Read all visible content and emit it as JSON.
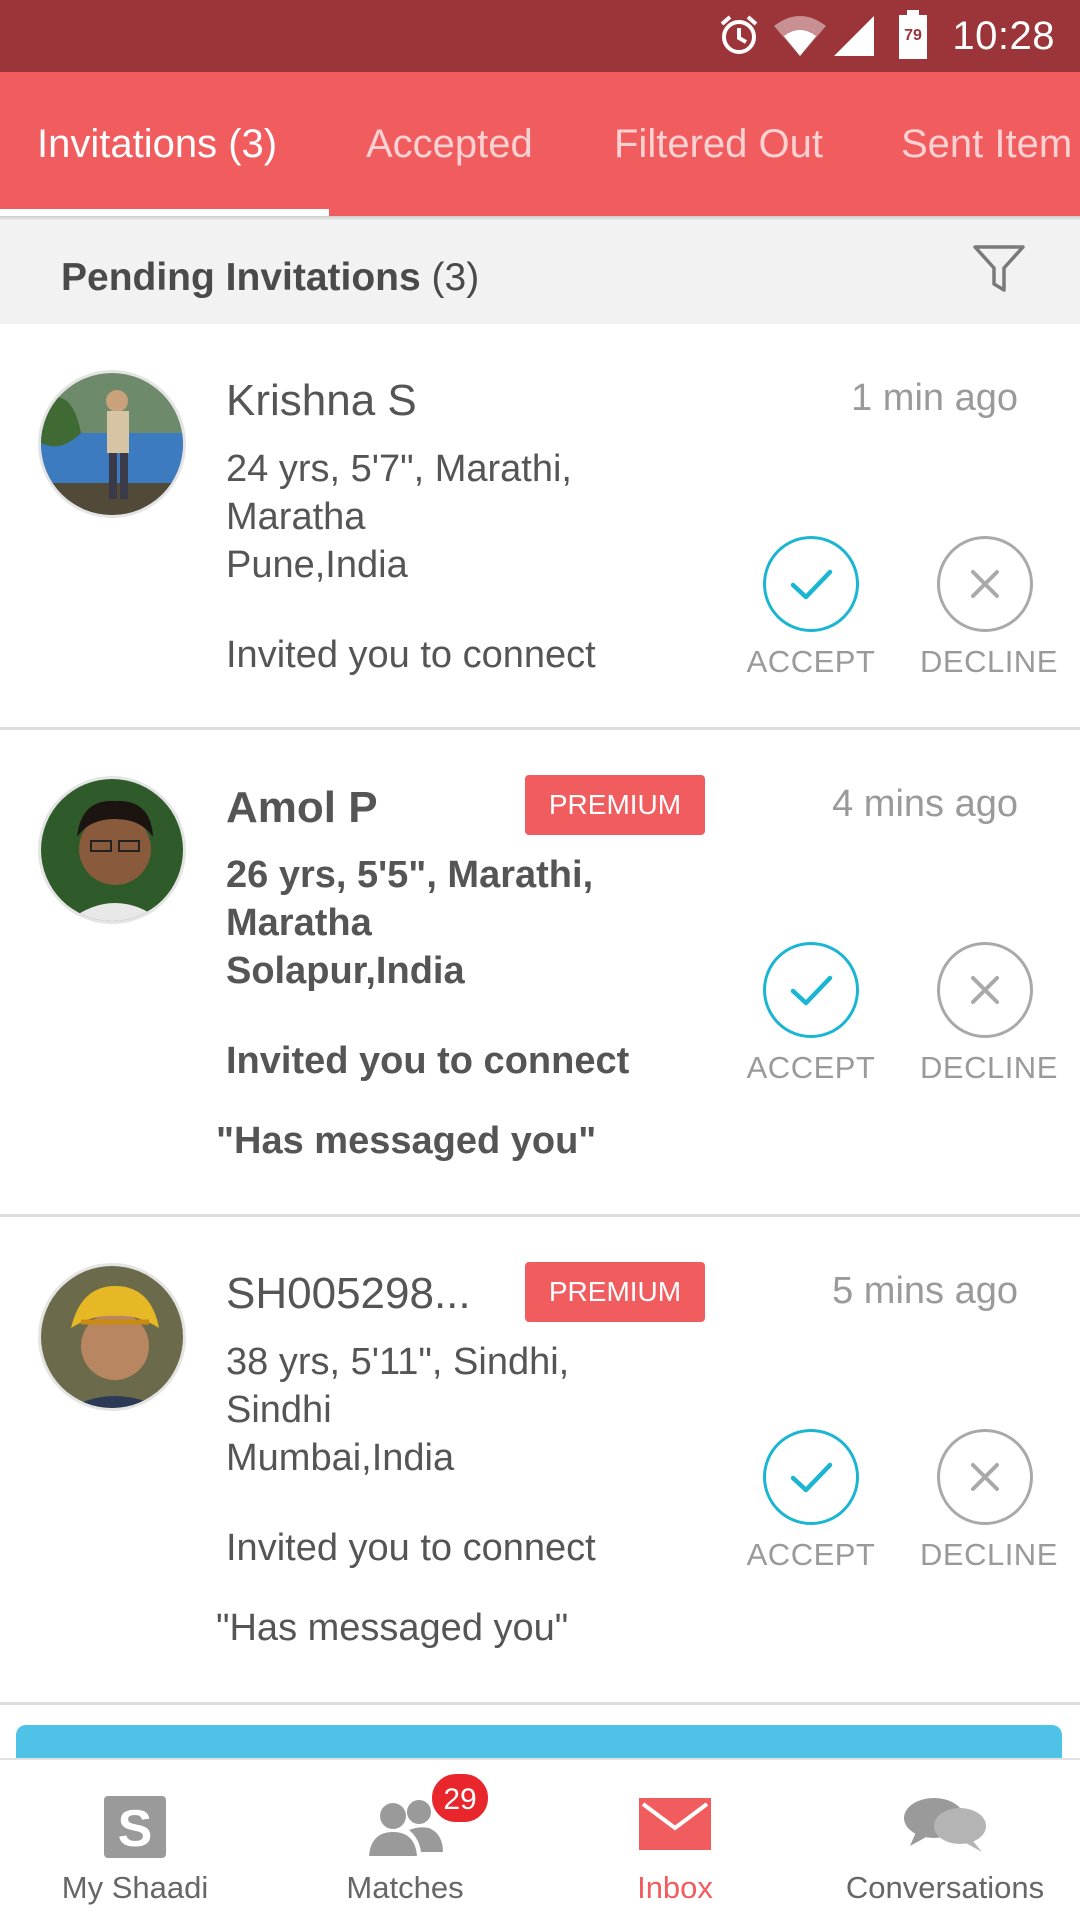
{
  "status_bar": {
    "time": "10:28",
    "battery_level": "79",
    "icons": [
      "alarm-icon",
      "wifi-icon",
      "signal-icon",
      "battery-icon"
    ]
  },
  "tabs": [
    {
      "label": "Invitations (3)",
      "active": true
    },
    {
      "label": "Accepted",
      "active": false
    },
    {
      "label": "Filtered Out",
      "active": false
    },
    {
      "label": "Sent Item",
      "active": false
    }
  ],
  "section": {
    "title": "Pending Invitations",
    "count": "(3)",
    "filter_icon": "filter-icon"
  },
  "invitations": [
    {
      "name": "Krishna S",
      "premium": false,
      "badge": "",
      "time": "1 min ago",
      "line1": "24 yrs, 5'7\", Marathi,",
      "line2": "Maratha",
      "line3": "Pune,India",
      "invite": "Invited you to connect",
      "message": ""
    },
    {
      "name": "Amol P",
      "premium": true,
      "badge": "PREMIUM",
      "time": "4 mins ago",
      "line1": "26 yrs, 5'5\", Marathi,",
      "line2": "Maratha",
      "line3": "Solapur,India",
      "invite": "Invited you to connect",
      "message": "\"Has messaged you\""
    },
    {
      "name": "SH005298...",
      "premium": true,
      "badge": "PREMIUM",
      "time": "5 mins ago",
      "line1": "38 yrs, 5'11\", Sindhi,",
      "line2": "Sindhi",
      "line3": "Mumbai,India",
      "invite": "Invited you to connect",
      "message": "\"Has messaged you\""
    }
  ],
  "actions": {
    "accept": "ACCEPT",
    "decline": "DECLINE"
  },
  "bottom_nav": [
    {
      "label": "My Shaadi",
      "icon": "shaadi-logo-icon",
      "active": false
    },
    {
      "label": "Matches",
      "icon": "people-icon",
      "active": false,
      "badge": "29"
    },
    {
      "label": "Inbox",
      "icon": "envelope-icon",
      "active": true
    },
    {
      "label": "Conversations",
      "icon": "chat-bubbles-icon",
      "active": false
    }
  ],
  "colors": {
    "status_bar": "#9b3539",
    "brand": "#f15c5f",
    "accept": "#19b5d2",
    "decline": "#a9a9a9",
    "badge": "#e8262b"
  }
}
